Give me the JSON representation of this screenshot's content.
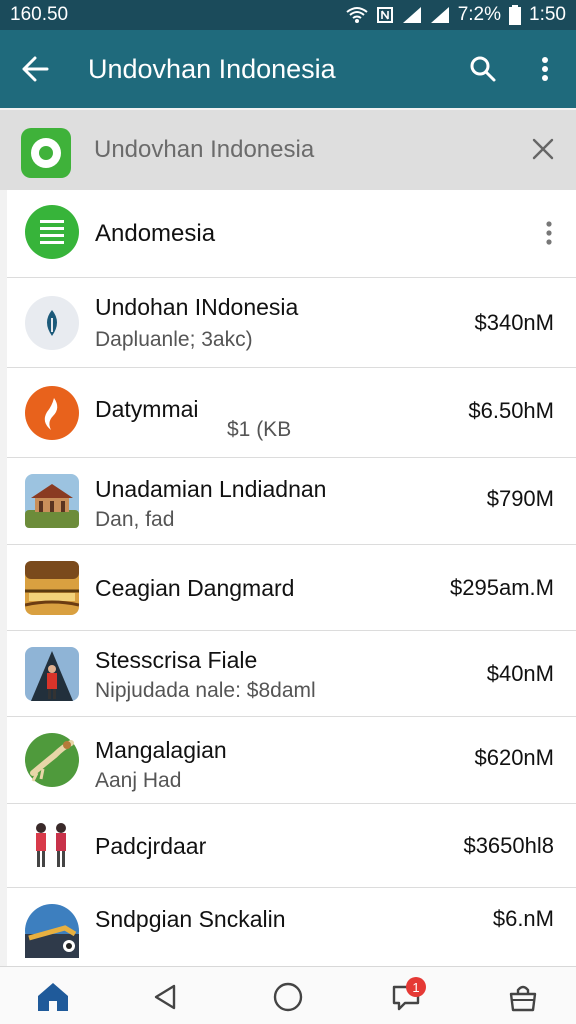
{
  "status_bar": {
    "left_text": "160.50",
    "battery_text": "7:2%",
    "time": "1:50"
  },
  "app_bar": {
    "title": "Undovhan Indonesia"
  },
  "search": {
    "text": "Undovhan Indonesia"
  },
  "section": {
    "title": "Andomesia"
  },
  "items": [
    {
      "name": "Undohan INdonesia",
      "sub": "Dapluanle; 3akc)",
      "price": "$340nM",
      "icon": "leaf-logo-icon"
    },
    {
      "name": "Datymmai",
      "sub": "$1 (KB",
      "price": "$6.50hM",
      "icon": "orange-logo-icon"
    },
    {
      "name": "Unadamian Lndiadnan",
      "sub": "Dan, fad",
      "price": "$790M",
      "icon": "pavilion-photo"
    },
    {
      "name": "Ceagian Dangmard",
      "sub": "",
      "price": "$295am.M",
      "icon": "boat-photo"
    },
    {
      "name": "Stesscrisa Fiale",
      "sub": "Nipjudada nale: $8daml",
      "price": "$40nM",
      "icon": "dancer-photo"
    },
    {
      "name": "Mangalagian",
      "sub": "Aanj Had",
      "price": "$620nM",
      "icon": "field-photo"
    },
    {
      "name": "Padcjrdaar",
      "sub": "",
      "price": "$3650hl8",
      "icon": "people-figures"
    },
    {
      "name": "Sndpgian Snckalin",
      "sub": "",
      "price": "$6.nM",
      "icon": "landscape-photo"
    }
  ],
  "bottom_nav": {
    "badge_count": "1"
  },
  "colors": {
    "status_bar": "#1b4b5b",
    "app_bar": "#1f6a7c",
    "accent_green": "#3fb23a",
    "badge_red": "#e53935"
  }
}
